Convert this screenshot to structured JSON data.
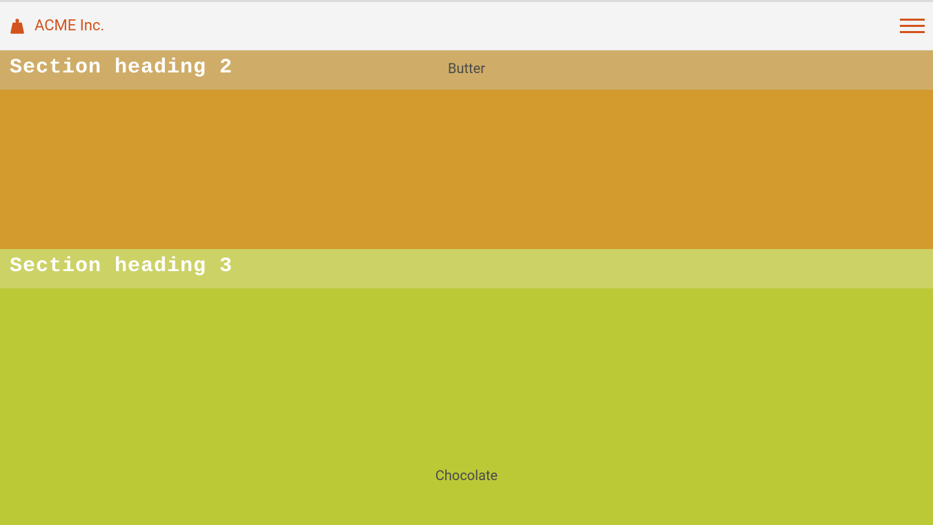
{
  "header": {
    "brand_name": "ACME Inc."
  },
  "sections": {
    "s2": {
      "heading": "Section heading 2",
      "label": "Butter"
    },
    "s3": {
      "heading": "Section heading 3",
      "label": "Chocolate"
    }
  },
  "colors": {
    "accent": "#d2541c",
    "section2_header": "#cfad68",
    "section2_body": "#d39b2e",
    "section3_header": "#ccd266",
    "section3_body": "#bcc937"
  }
}
